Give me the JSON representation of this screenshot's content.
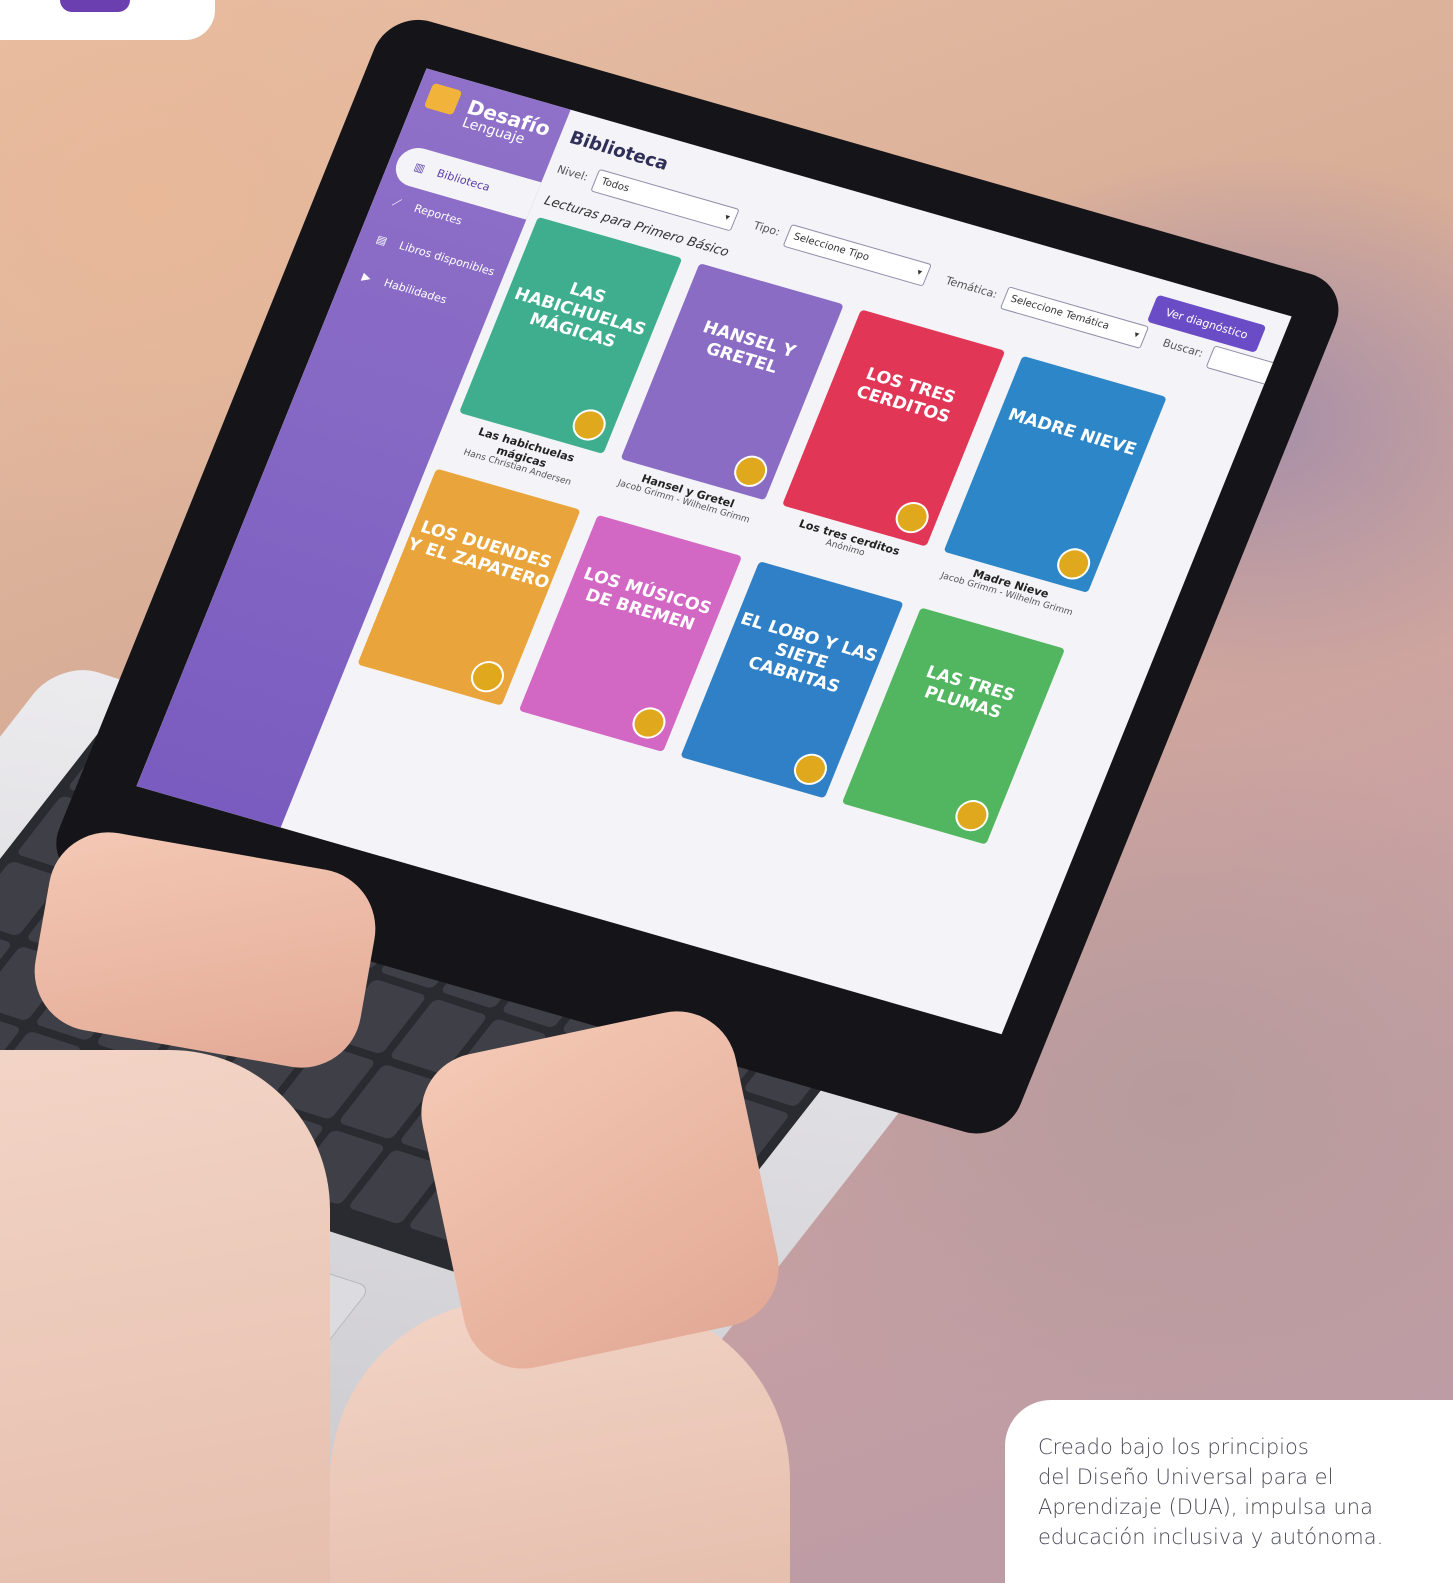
{
  "caption": "Creado bajo los principios\ndel Diseño Universal para el\nAprendizaje (DUA), impulsa una\neducación inclusiva y autónoma.",
  "app": {
    "logo_title": "Desafío",
    "logo_sub": "Lenguaje",
    "nav": [
      {
        "label": "Biblioteca",
        "icon": "books-icon",
        "active": true
      },
      {
        "label": "Reportes",
        "icon": "chart-icon",
        "active": false
      },
      {
        "label": "Libros disponibles",
        "icon": "library-icon",
        "active": false
      },
      {
        "label": "Habilidades",
        "icon": "video-icon",
        "active": false
      }
    ],
    "page_title": "Biblioteca",
    "filters": {
      "nivel_label": "Nivel:",
      "nivel_value": "Todos",
      "tipo_label": "Tipo:",
      "tipo_value": "Seleccione Tipo",
      "tematica_label": "Temática:",
      "tematica_value": "Seleccione Temática",
      "buscar_label": "Buscar:"
    },
    "diagnostic_button": "Ver diagnóstico",
    "section_title": "Lecturas para Primero Básico",
    "books": [
      {
        "cover_title": "LAS HABICHUELAS MÁGICAS",
        "title": "Las habichuelas mágicas",
        "author": "Hans Christian Andersen",
        "color": "#3fae8e"
      },
      {
        "cover_title": "HANSEL Y GRETEL",
        "title": "Hansel y Gretel",
        "author": "Jacob Grimm - Wilhelm Grimm",
        "color": "#8a6cc4"
      },
      {
        "cover_title": "LOS TRES CERDITOS",
        "title": "Los tres cerditos",
        "author": "Anónimo",
        "color": "#e23657"
      },
      {
        "cover_title": "MADRE NIEVE",
        "title": "Madre Nieve",
        "author": "Jacob Grimm - Wilhelm Grimm",
        "color": "#2c86c7"
      },
      {
        "cover_title": "LOS DUENDES Y EL ZAPATERO",
        "title": "",
        "author": "",
        "color": "#e9a53b"
      },
      {
        "cover_title": "LOS MÚSICOS DE BREMEN",
        "title": "",
        "author": "",
        "color": "#d367c4"
      },
      {
        "cover_title": "EL LOBO Y LAS SIETE CABRITAS",
        "title": "",
        "author": "",
        "color": "#2f80c6"
      },
      {
        "cover_title": "LAS TRES PLUMAS",
        "title": "",
        "author": "",
        "color": "#52b560"
      }
    ]
  },
  "colors": {
    "brand_purple": "#6b3fb0",
    "sidebar": "#8a6bc6",
    "caption_text": "#4a4a58"
  }
}
